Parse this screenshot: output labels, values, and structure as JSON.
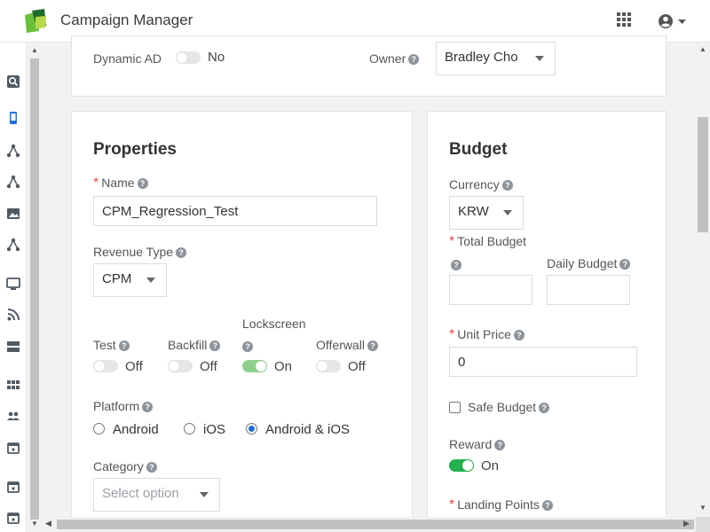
{
  "app": {
    "title": "Campaign Manager",
    "brand_colors": [
      "#6abf3a",
      "#1e6b2a",
      "#b8d94a"
    ]
  },
  "header": {
    "apps_icon": "grid-apps-icon",
    "account_icon": "account-circle-icon"
  },
  "sidebar": {
    "icons": [
      "search-icon",
      "mobile-icon",
      "network-icon",
      "network-icon",
      "image-icon",
      "network-icon",
      "monitor-icon",
      "rss-icon",
      "storage-icon",
      "grid-icon",
      "people-icon",
      "calendar-icon",
      "calendar-icon",
      "calendar-icon"
    ],
    "active_index": 1,
    "active_color": "#1f6fd8"
  },
  "top_card": {
    "dynamic_ad": {
      "label": "Dynamic AD",
      "value": "No"
    },
    "owner": {
      "label": "Owner",
      "value": "Bradley Cho"
    }
  },
  "properties": {
    "title": "Properties",
    "name": {
      "label": "Name",
      "value": "CPM_Regression_Test"
    },
    "revenue_type": {
      "label": "Revenue Type",
      "value": "CPM"
    },
    "toggles": [
      {
        "label": "Test",
        "state": "Off"
      },
      {
        "label": "Backfill",
        "state": "Off"
      },
      {
        "label": "Lockscreen",
        "state": "On"
      },
      {
        "label": "Offerwall",
        "state": "Off"
      }
    ],
    "platform": {
      "label": "Platform",
      "options": [
        "Android",
        "iOS",
        "Android & iOS"
      ],
      "selected": "Android & iOS"
    },
    "category": {
      "label": "Category",
      "placeholder": "Select option"
    }
  },
  "budget": {
    "title": "Budget",
    "currency": {
      "label": "Currency",
      "value": "KRW"
    },
    "total_budget": {
      "label": "Total Budget",
      "value": ""
    },
    "daily_budget": {
      "label": "Daily Budget",
      "value": ""
    },
    "unit_price": {
      "label": "Unit Price",
      "value": "0"
    },
    "safe_budget": {
      "label": "Safe Budget",
      "checked": false
    },
    "reward": {
      "label": "Reward",
      "state": "On"
    },
    "landing_points": {
      "label": "Landing Points"
    }
  }
}
